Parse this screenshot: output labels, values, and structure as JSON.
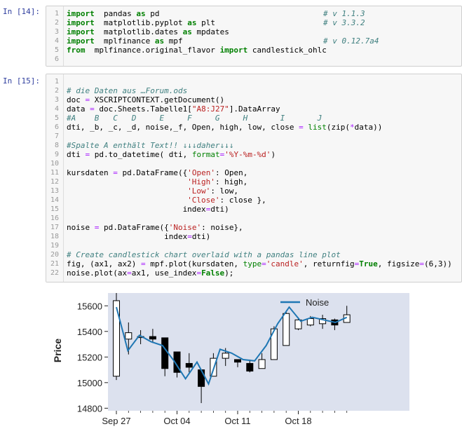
{
  "cell1": {
    "prompt": "In [14]:",
    "lines": [
      {
        "n": "1",
        "parts": [
          [
            "kw",
            "import"
          ],
          [
            "",
            "  pandas "
          ],
          [
            "kw",
            "as"
          ],
          [
            "",
            " pd"
          ]
        ],
        "note": "# v 1.1.3"
      },
      {
        "n": "2",
        "parts": [
          [
            "kw",
            "import"
          ],
          [
            "",
            "  matplotlib.pyplot "
          ],
          [
            "kw",
            "as"
          ],
          [
            "",
            " plt"
          ]
        ],
        "note": "# v 3.3.2"
      },
      {
        "n": "3",
        "parts": [
          [
            "kw",
            "import"
          ],
          [
            "",
            "  matplotlib.dates "
          ],
          [
            "kw",
            "as"
          ],
          [
            "",
            " mpdates"
          ]
        ],
        "note": ""
      },
      {
        "n": "4",
        "parts": [
          [
            "kw",
            "import"
          ],
          [
            "",
            "  mplfinance "
          ],
          [
            "kw",
            "as"
          ],
          [
            "",
            " mpf"
          ]
        ],
        "note": "# v 0.12.7a4"
      },
      {
        "n": "5",
        "parts": [
          [
            "kw",
            "from"
          ],
          [
            "",
            "  mplfinance.original_flavor "
          ],
          [
            "kw",
            "import"
          ],
          [
            "",
            " candlestick_ohlc"
          ]
        ],
        "note": ""
      },
      {
        "n": "6",
        "parts": [],
        "note": ""
      }
    ]
  },
  "cell2": {
    "prompt": "In [15]:",
    "lines": [
      {
        "n": "1",
        "parts": []
      },
      {
        "n": "2",
        "parts": [
          [
            "cm",
            "# die Daten aus …Forum.ods"
          ]
        ]
      },
      {
        "n": "3",
        "parts": [
          [
            "",
            "doc "
          ],
          [
            "op",
            "="
          ],
          [
            "",
            " XSCRIPTCONTEXT.getDocument()"
          ]
        ]
      },
      {
        "n": "4",
        "parts": [
          [
            "",
            "data "
          ],
          [
            "op",
            "="
          ],
          [
            "",
            " doc.Sheets.Tabelle1["
          ],
          [
            "st",
            "\"A8:J27\""
          ],
          [
            "",
            "].DataArray"
          ]
        ]
      },
      {
        "n": "5",
        "parts": [
          [
            "cm",
            "#A    B   C   D     E     F     G     H       I       J"
          ]
        ]
      },
      {
        "n": "6",
        "parts": [
          [
            "",
            "dti, _b, _c, _d, noise,_f, Open, high, low, close "
          ],
          [
            "op",
            "="
          ],
          [
            "",
            " "
          ],
          [
            "fn",
            "list"
          ],
          [
            "",
            "(zip("
          ],
          [
            "op",
            "*"
          ],
          [
            "",
            "data))"
          ]
        ]
      },
      {
        "n": "7",
        "parts": []
      },
      {
        "n": "8",
        "parts": [
          [
            "cm",
            "#Spalte A enthält Text!! ↓↓↓daher↓↓↓"
          ]
        ]
      },
      {
        "n": "9",
        "parts": [
          [
            "",
            "dti "
          ],
          [
            "op",
            "="
          ],
          [
            "",
            " pd.to_datetime( dti, "
          ],
          [
            "fn",
            "format"
          ],
          [
            "op",
            "="
          ],
          [
            "st",
            "'%Y-%m-%d'"
          ],
          [
            "",
            ")"
          ]
        ]
      },
      {
        "n": "10",
        "parts": []
      },
      {
        "n": "11",
        "parts": [
          [
            "",
            "kursdaten "
          ],
          [
            "op",
            "="
          ],
          [
            "",
            " pd.DataFrame({"
          ],
          [
            "st",
            "'Open'"
          ],
          [
            "",
            ": Open,"
          ]
        ]
      },
      {
        "n": "12",
        "parts": [
          [
            "",
            "                          "
          ],
          [
            "st",
            "'High'"
          ],
          [
            "",
            ": high,"
          ]
        ]
      },
      {
        "n": "13",
        "parts": [
          [
            "",
            "                          "
          ],
          [
            "st",
            "'Low'"
          ],
          [
            "",
            ": low,"
          ]
        ]
      },
      {
        "n": "14",
        "parts": [
          [
            "",
            "                          "
          ],
          [
            "st",
            "'Close'"
          ],
          [
            "",
            ": close },"
          ]
        ]
      },
      {
        "n": "15",
        "parts": [
          [
            "",
            "                         index"
          ],
          [
            "op",
            "="
          ],
          [
            "",
            "dti)"
          ]
        ]
      },
      {
        "n": "16",
        "parts": []
      },
      {
        "n": "17",
        "parts": [
          [
            "",
            "noise "
          ],
          [
            "op",
            "="
          ],
          [
            "",
            " pd.DataFrame({"
          ],
          [
            "st",
            "'Noise'"
          ],
          [
            "",
            ": noise},"
          ]
        ]
      },
      {
        "n": "18",
        "parts": [
          [
            "",
            "                     index"
          ],
          [
            "op",
            "="
          ],
          [
            "",
            "dti)"
          ]
        ]
      },
      {
        "n": "19",
        "parts": []
      },
      {
        "n": "20",
        "parts": [
          [
            "cm",
            "# Create candlestick chart overlaid with a pandas line plot"
          ]
        ]
      },
      {
        "n": "21",
        "parts": [
          [
            "",
            "fig, (ax1, ax2) "
          ],
          [
            "op",
            "="
          ],
          [
            "",
            " mpf.plot(kursdaten, "
          ],
          [
            "fn",
            "type"
          ],
          [
            "op",
            "="
          ],
          [
            "st",
            "'candle'"
          ],
          [
            "",
            ", returnfig"
          ],
          [
            "op",
            "="
          ],
          [
            "kw",
            "True"
          ],
          [
            "",
            ", figsize"
          ],
          [
            "op",
            "="
          ],
          [
            "",
            "(6,3))"
          ]
        ]
      },
      {
        "n": "22",
        "parts": [
          [
            "",
            "noise.plot(ax"
          ],
          [
            "op",
            "="
          ],
          [
            "",
            "ax1, use_index"
          ],
          [
            "op",
            "="
          ],
          [
            "kw",
            "False"
          ],
          [
            "",
            ");"
          ]
        ]
      }
    ]
  },
  "chart_data": {
    "type": "candlestick",
    "ylabel": "Price",
    "ylim": [
      14780,
      15700
    ],
    "yticks": [
      "15600",
      "15400",
      "15200",
      "15000",
      "14800"
    ],
    "xticks": [
      "Sep 27",
      "Oct 04",
      "Oct 11",
      "Oct 18"
    ],
    "legend": [
      "Noise"
    ],
    "legend_position": "top-right",
    "colors": {
      "up": "#ffffff",
      "down": "#000000",
      "line": "#1f77b4",
      "bg": "#dce1ee"
    },
    "candles": [
      {
        "o": 15050,
        "h": 15700,
        "l": 15020,
        "c": 15640
      },
      {
        "o": 15340,
        "h": 15470,
        "l": 15220,
        "c": 15390
      },
      {
        "o": 15360,
        "h": 15410,
        "l": 15300,
        "c": 15360
      },
      {
        "o": 15360,
        "h": 15420,
        "l": 15310,
        "c": 15340
      },
      {
        "o": 15350,
        "h": 15350,
        "l": 15050,
        "c": 15110
      },
      {
        "o": 15240,
        "h": 15240,
        "l": 15040,
        "c": 15080
      },
      {
        "o": 15150,
        "h": 15230,
        "l": 15080,
        "c": 15120
      },
      {
        "o": 15100,
        "h": 15100,
        "l": 14840,
        "c": 14970
      },
      {
        "o": 15050,
        "h": 15230,
        "l": 15050,
        "c": 15190
      },
      {
        "o": 15190,
        "h": 15270,
        "l": 15130,
        "c": 15230
      },
      {
        "o": 15180,
        "h": 15180,
        "l": 15120,
        "c": 15160
      },
      {
        "o": 15150,
        "h": 15180,
        "l": 15080,
        "c": 15090
      },
      {
        "o": 15110,
        "h": 15230,
        "l": 15110,
        "c": 15180
      },
      {
        "o": 15180,
        "h": 15440,
        "l": 15180,
        "c": 15420
      },
      {
        "o": 15290,
        "h": 15560,
        "l": 15290,
        "c": 15540
      },
      {
        "o": 15420,
        "h": 15510,
        "l": 15410,
        "c": 15490
      },
      {
        "o": 15450,
        "h": 15520,
        "l": 15440,
        "c": 15500
      },
      {
        "o": 15460,
        "h": 15530,
        "l": 15420,
        "c": 15500
      },
      {
        "o": 15490,
        "h": 15500,
        "l": 15410,
        "c": 15450
      },
      {
        "o": 15470,
        "h": 15600,
        "l": 15470,
        "c": 15530
      }
    ],
    "noise": [
      15590,
      15250,
      15370,
      15320,
      15290,
      15170,
      15030,
      15160,
      14990,
      15260,
      15230,
      15180,
      15170,
      15290,
      15460,
      15590,
      15480,
      15510,
      15490,
      15470,
      15510
    ]
  }
}
